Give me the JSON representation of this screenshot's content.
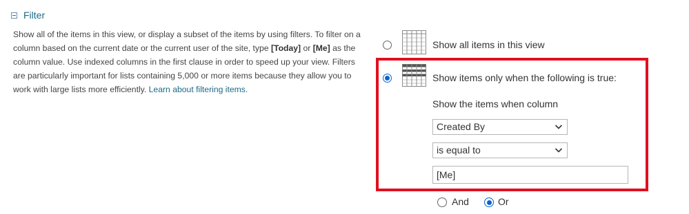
{
  "section": {
    "title": "Filter"
  },
  "description": {
    "part1": "Show all of the items in this view, or display a subset of the items by using filters. To filter on a column based on the current date or the current user of the site, type ",
    "today_token": "[Today]",
    "part2": " or ",
    "me_token": "[Me]",
    "part3": " as the column value. Use indexed columns in the first clause in order to speed up your view. Filters are particularly important for lists containing 5,000 or more items because they allow you to work with large lists more efficiently. ",
    "link_text": "Learn about filtering items."
  },
  "options": {
    "show_all_label": "Show all items in this view",
    "show_when_label": "Show items only when the following is true:",
    "selected": "show_when"
  },
  "filter": {
    "column_label": "Show the items when column",
    "column_value": "Created By",
    "operator_value": "is equal to",
    "value": "[Me]",
    "and_label": "And",
    "or_label": "Or",
    "conjunction_selected": "Or"
  },
  "colors": {
    "highlight": "#e0101f",
    "link": "#1b6a86",
    "radio_selected": "#0a63c9"
  },
  "icons": {
    "section_toggle": "collapse-minus-icon",
    "show_all": "grid-list-icon",
    "show_when": "filtered-grid-icon",
    "dropdown": "chevron-down-icon"
  }
}
